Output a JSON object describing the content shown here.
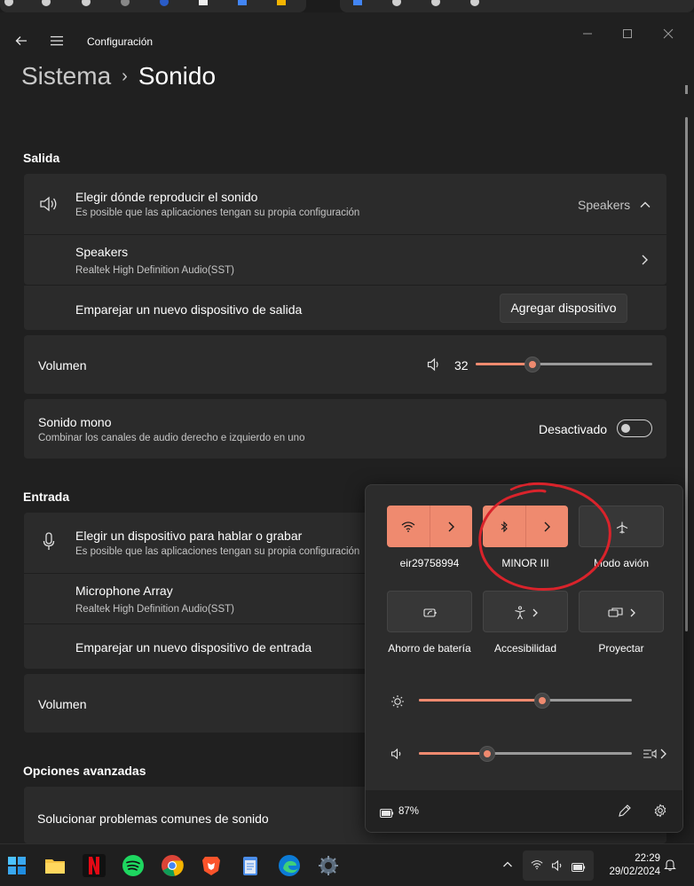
{
  "app": {
    "title": "Configuración"
  },
  "breadcrumb": {
    "parent": "Sistema",
    "separator": "›",
    "current": "Sonido"
  },
  "output": {
    "section_title": "Salida",
    "choose_device": {
      "title": "Elegir dónde reproducir el sonido",
      "subtitle": "Es posible que las aplicaciones tengan su propia configuración",
      "value": "Speakers"
    },
    "device": {
      "name": "Speakers",
      "driver": "Realtek High Definition Audio(SST)"
    },
    "pair": {
      "label": "Emparejar un nuevo dispositivo de salida",
      "button": "Agregar dispositivo"
    },
    "volume": {
      "label": "Volumen",
      "value": "32",
      "level": 0.32
    },
    "mono": {
      "title": "Sonido mono",
      "subtitle": "Combinar los canales de audio derecho e izquierdo en uno",
      "state": "Desactivado",
      "on": false
    }
  },
  "input": {
    "section_title": "Entrada",
    "choose_device": {
      "title": "Elegir un dispositivo para hablar o grabar",
      "subtitle": "Es posible que las aplicaciones tengan su propia configuración"
    },
    "device": {
      "name": "Microphone Array",
      "driver": "Realtek High Definition Audio(SST)"
    },
    "pair": {
      "label": "Emparejar un nuevo dispositivo de entrada"
    },
    "volume": {
      "label": "Volumen"
    }
  },
  "advanced": {
    "section_title": "Opciones avanzadas",
    "troubleshoot": "Solucionar problemas comunes de sonido"
  },
  "quick_settings": {
    "tiles": [
      {
        "label": "eir29758994",
        "icon": "wifi-icon",
        "active": true
      },
      {
        "label": "MINOR III",
        "icon": "bluetooth-icon",
        "active": true
      },
      {
        "label": "Modo avión",
        "icon": "airplane-icon",
        "active": false
      },
      {
        "label": "Ahorro de batería",
        "icon": "battery-saver-icon",
        "active": false
      },
      {
        "label": "Accesibilidad",
        "icon": "accessibility-icon",
        "active": false
      },
      {
        "label": "Proyectar",
        "icon": "project-icon",
        "active": false
      }
    ],
    "brightness_level": 0.58,
    "volume_level": 0.32,
    "battery": "87%"
  },
  "taskbar": {
    "apps": [
      "start",
      "file-explorer",
      "netflix",
      "spotify",
      "chrome",
      "brave",
      "notepad",
      "edge",
      "settings"
    ],
    "time": "22:29",
    "date": "29/02/2024"
  },
  "colors": {
    "accent": "#ef8a6f",
    "background": "#202020",
    "card": "#2b2b2b",
    "annotation": "#d9232b"
  }
}
